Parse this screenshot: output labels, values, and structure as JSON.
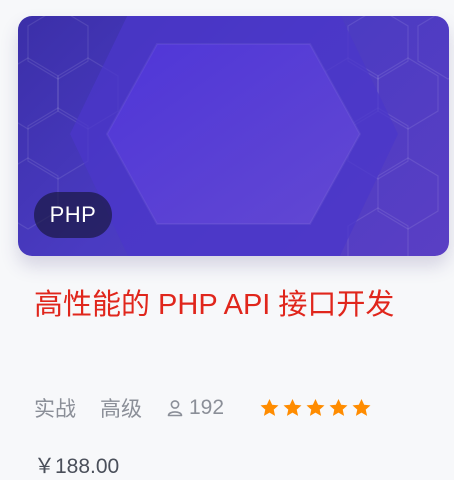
{
  "course": {
    "tag": "PHP",
    "title": "高性能的 PHP API 接口开发",
    "type": "实战",
    "level": "高级",
    "students": "192",
    "rating_stars": 5,
    "price": "￥188.00"
  },
  "colors": {
    "title": "#e0261c",
    "star": "#ff8c00",
    "banner_primary": "#4a3bc2",
    "banner_hexagon": "#5b45d6"
  },
  "icons": {
    "students": "user-icon",
    "rating": "star-icon"
  }
}
